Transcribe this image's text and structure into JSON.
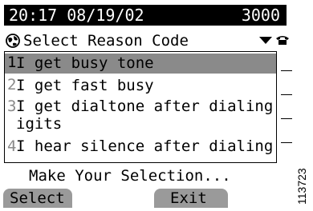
{
  "status": {
    "datetime": "20:17 08/19/02",
    "extension": "3000"
  },
  "title": {
    "icon": "globe-icon",
    "label": "Select Reason Code",
    "dropdown_icon": "triangle-down-icon"
  },
  "side_icon": "phone-icon",
  "list": {
    "items": [
      {
        "num": "1",
        "text": "I get busy tone",
        "selected": true
      },
      {
        "num": "2",
        "text": "I get fast busy",
        "selected": false
      },
      {
        "num": "3",
        "text": "I get dialtone after dialing d\nigits",
        "selected": false
      },
      {
        "num": "4",
        "text": "I hear silence after dialing",
        "selected": false
      }
    ]
  },
  "prompt": "Make Your Selection...",
  "softkeys": {
    "select": "Select",
    "exit": "Exit"
  },
  "image_id": "113723"
}
